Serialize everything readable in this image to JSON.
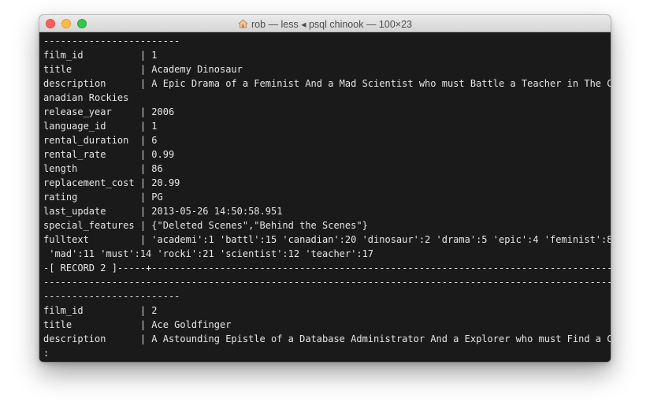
{
  "window": {
    "title": "rob — less ◂ psql chinook — 100×23",
    "home_icon": "home-icon"
  },
  "colors": {
    "terminal_bg": "#1a1a1a",
    "terminal_text": "#e6e6e6",
    "close": "#fc605c",
    "minimize": "#fdbc40",
    "maximize": "#34c84a"
  },
  "terminal": {
    "lines": [
      "------------------------",
      "film_id          | 1",
      "title            | Academy Dinosaur",
      "description      | A Epic Drama of a Feminist And a Mad Scientist who must Battle a Teacher in The C",
      "anadian Rockies",
      "release_year     | 2006",
      "language_id      | 1",
      "rental_duration  | 6",
      "rental_rate      | 0.99",
      "length           | 86",
      "replacement_cost | 20.99",
      "rating           | PG",
      "last_update      | 2013-05-26 14:50:58.951",
      "special_features | {\"Deleted Scenes\",\"Behind the Scenes\"}",
      "fulltext         | 'academi':1 'battl':15 'canadian':20 'dinosaur':2 'drama':5 'epic':4 'feminist':8",
      " 'mad':11 'must':14 'rocki':21 'scientist':12 'teacher':17",
      "-[ RECORD 2 ]-----+-----------------------------------------------------------------------------------------",
      "----------------------------------------------------------------------------------------------------",
      "------------------------",
      "film_id          | 2",
      "title            | Ace Goldfinger",
      "description      | A Astounding Epistle of a Database Administrator And a Explorer who must Find a C",
      ":"
    ]
  }
}
